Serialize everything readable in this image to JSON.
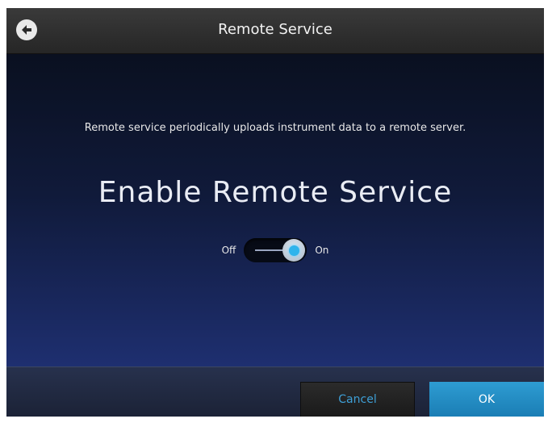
{
  "header": {
    "title": "Remote Service",
    "back_icon": "back-arrow-icon"
  },
  "main": {
    "description": "Remote service periodically uploads instrument data to a remote server.",
    "heading": "Enable Remote Service",
    "toggle": {
      "off_label": "Off",
      "on_label": "On",
      "state": "on"
    }
  },
  "footer": {
    "cancel_label": "Cancel",
    "ok_label": "OK"
  },
  "colors": {
    "accent": "#2fb4ec",
    "ok_button": "#1f8fc8",
    "cancel_text": "#3e9fd6"
  }
}
